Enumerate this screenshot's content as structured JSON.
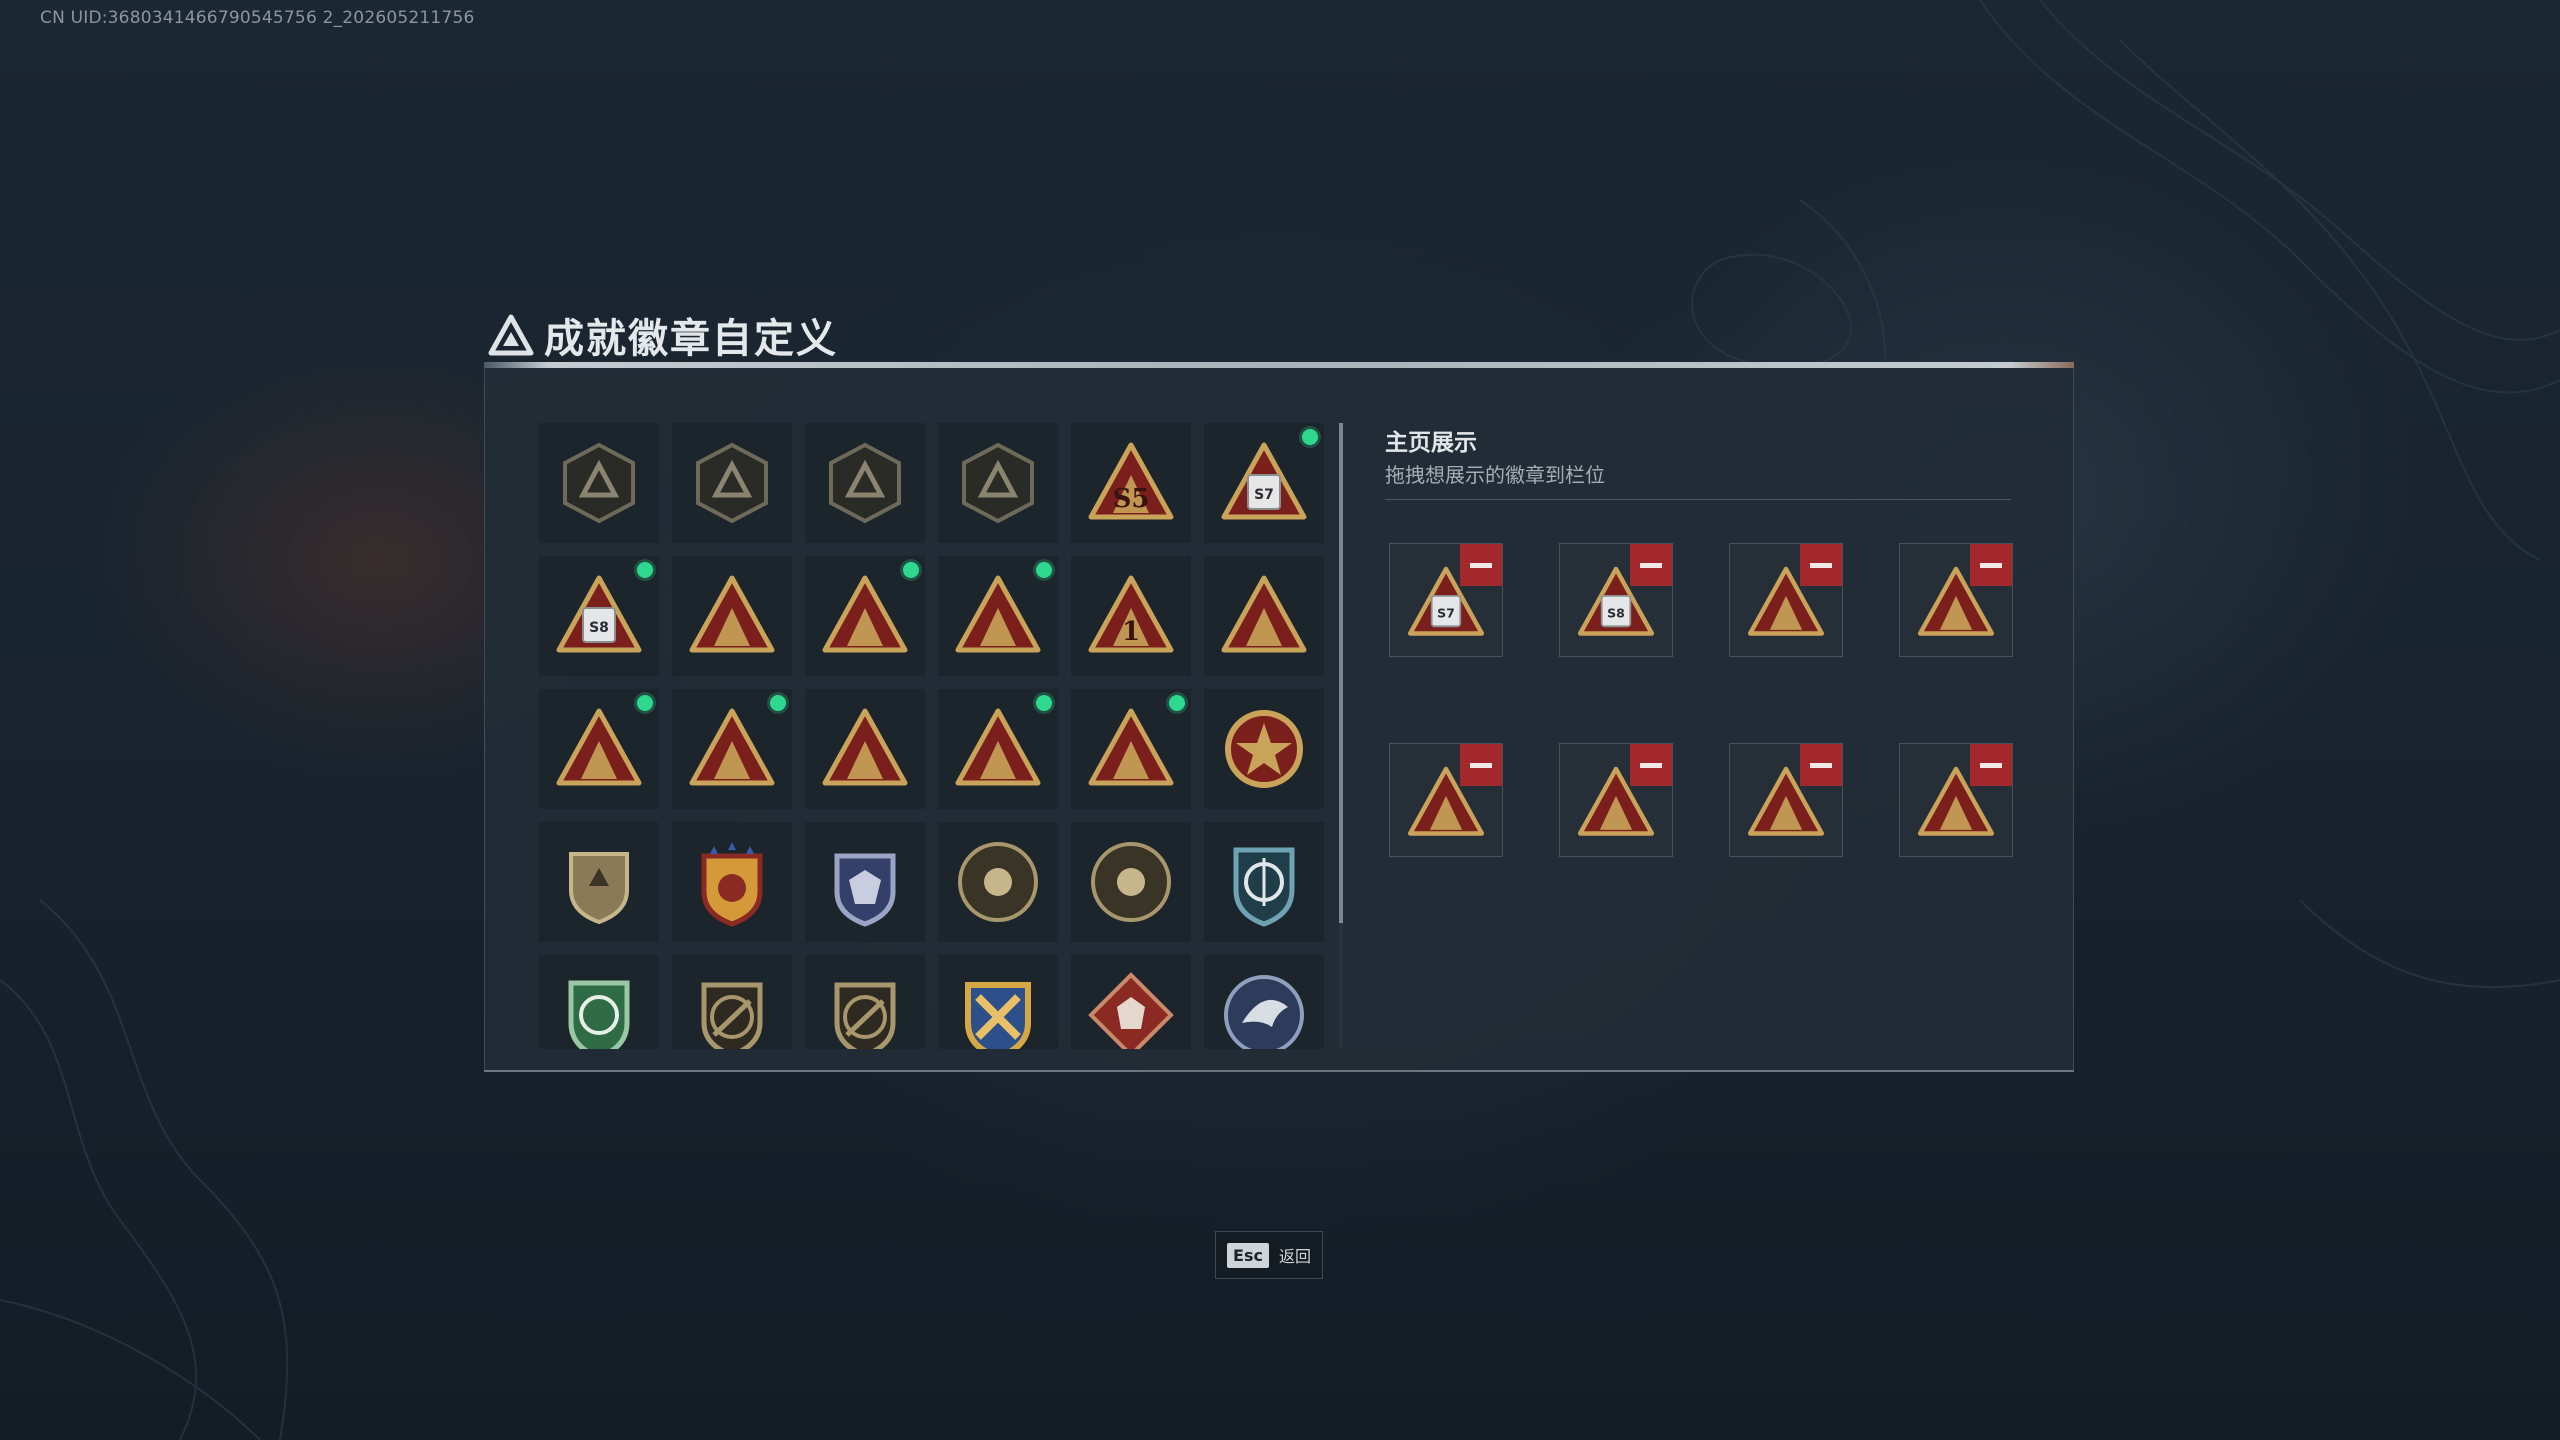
{
  "uid_text": "CN UID:3680341466790545756 2_202605211756",
  "dialog": {
    "title": "成就徽章自定义"
  },
  "badges": [
    {
      "icon": "hex-delta-badge-icon",
      "new": false,
      "style": "hexdark"
    },
    {
      "icon": "helicopter-hex-badge-icon",
      "new": false,
      "style": "hexdark"
    },
    {
      "icon": "diamond-hex-badge-icon",
      "new": false,
      "style": "hexdark"
    },
    {
      "icon": "dagger-shield-badge-icon",
      "new": false,
      "style": "hexdark"
    },
    {
      "icon": "triangle-s5-badge-icon",
      "new": false,
      "style": "trigold",
      "label": "S5"
    },
    {
      "icon": "triangle-s7-badge-icon",
      "new": true,
      "style": "tricard",
      "label": "S7"
    },
    {
      "icon": "triangle-s8-badge-icon",
      "new": true,
      "style": "tricard",
      "label": "S8"
    },
    {
      "icon": "triangle-helicopter-badge-icon",
      "new": false,
      "style": "trigold"
    },
    {
      "icon": "triangle-trophy-badge-icon",
      "new": true,
      "style": "trigold"
    },
    {
      "icon": "triangle-helmet-badge-icon",
      "new": true,
      "style": "trigold"
    },
    {
      "icon": "triangle-number-one-badge-icon",
      "new": false,
      "style": "trigold",
      "label": "1"
    },
    {
      "icon": "triangle-case-badge-icon",
      "new": false,
      "style": "trigold"
    },
    {
      "icon": "triangle-soldier-badge-icon",
      "new": true,
      "style": "trigold"
    },
    {
      "icon": "triangle-emblem-badge-icon",
      "new": true,
      "style": "trigold"
    },
    {
      "icon": "triangle-squad-badge-icon",
      "new": false,
      "style": "trigold"
    },
    {
      "icon": "triangle-rocket-badge-icon",
      "new": true,
      "style": "trigold"
    },
    {
      "icon": "triangle-rifle-badge-icon",
      "new": true,
      "style": "trigold"
    },
    {
      "icon": "star-medal-badge-icon",
      "new": false,
      "style": "medal"
    },
    {
      "icon": "shield-crest-badge-icon",
      "new": false,
      "style": "shieldtan"
    },
    {
      "icon": "star-shield-orange-badge-icon",
      "new": false,
      "style": "shieldorange"
    },
    {
      "icon": "star-shield-blue-badge-icon",
      "new": false,
      "style": "shieldblue"
    },
    {
      "icon": "compass-round-badge-icon",
      "new": false,
      "style": "round"
    },
    {
      "icon": "skull-round-badge-icon",
      "new": false,
      "style": "round"
    },
    {
      "icon": "crosshair-shield-badge-icon",
      "new": false,
      "style": "shieldnavy"
    },
    {
      "icon": "crosshair-green-shield-badge-icon",
      "new": false,
      "style": "shieldgreen"
    },
    {
      "icon": "rifle-shield-badge-icon",
      "new": false,
      "style": "shieldtan2"
    },
    {
      "icon": "sniper-shield-badge-icon",
      "new": false,
      "style": "shieldtan2"
    },
    {
      "icon": "crossed-guns-badge-icon",
      "new": false,
      "style": "shieldgoldblue"
    },
    {
      "icon": "wolf-diamond-badge-icon",
      "new": false,
      "style": "diamondred"
    },
    {
      "icon": "eagle-round-badge-icon",
      "new": false,
      "style": "roundblue"
    }
  ],
  "showcase": {
    "title": "主页展示",
    "subtitle": "拖拽想展示的徽章到栏位",
    "remove_label": "−",
    "slots": [
      {
        "icon": "triangle-s7-badge-icon",
        "style": "tricard",
        "label": "S7"
      },
      {
        "icon": "triangle-s8-badge-icon",
        "style": "tricard",
        "label": "S8"
      },
      {
        "icon": "triangle-rifle-badge-icon",
        "style": "trigold"
      },
      {
        "icon": "triangle-trophy-badge-icon",
        "style": "trigold"
      },
      {
        "icon": "triangle-soldier-badge-icon",
        "style": "trigold"
      },
      {
        "icon": "triangle-emblem-badge-icon",
        "style": "trigold"
      },
      {
        "icon": "triangle-helmet-badge-icon",
        "style": "trigold"
      },
      {
        "icon": "triangle-rocket-badge-icon",
        "style": "trigold"
      }
    ]
  },
  "footer": {
    "esc_key": "Esc",
    "esc_label": "返回"
  },
  "colors": {
    "new_dot": "#2fd88f",
    "remove_button": "#a3282c",
    "gold": "#c9a35a",
    "badge_red": "#7a1f1c"
  }
}
